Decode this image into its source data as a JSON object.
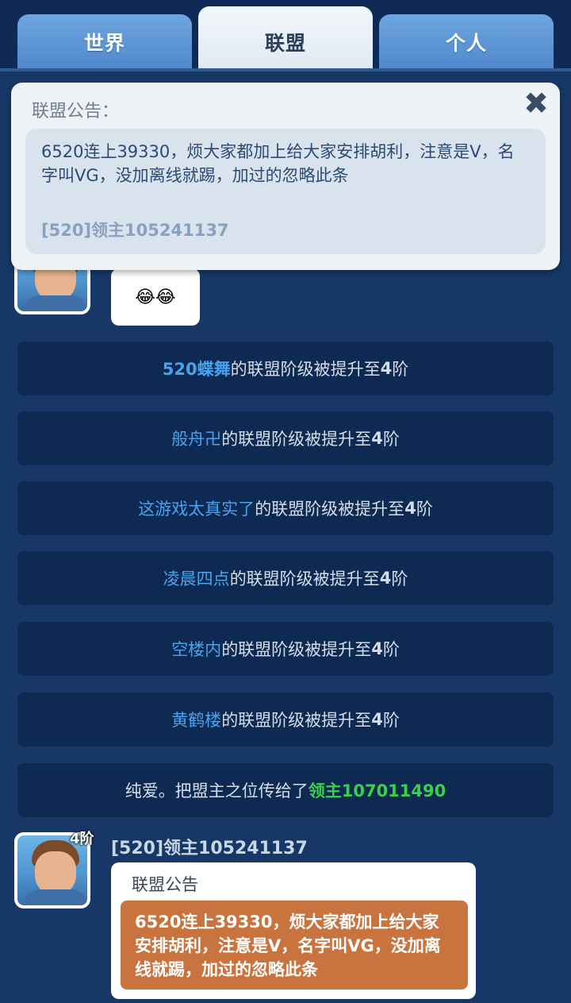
{
  "tabs": {
    "world": "世界",
    "alliance": "联盟",
    "personal": "个人"
  },
  "notice": {
    "title": "联盟公告：",
    "text": "6520连上39330，烦大家都加上给大家安排胡利，注意是V，名字叫VG，没加离线就踢，加过的忽略此条",
    "sender": "[520]领主105241137",
    "close_icon": "✖"
  },
  "emoji_message": {
    "content": "😂😂"
  },
  "system_rows": [
    {
      "name": "520蝶舞",
      "suffix": "的联盟阶级被提升至",
      "level": "4",
      "unit": "阶"
    },
    {
      "name": "般舟卍",
      "suffix": "的联盟阶级被提升至",
      "level": "4",
      "unit": "阶"
    },
    {
      "name": "这游戏太真实了",
      "suffix": "的联盟阶级被提升至",
      "level": "4",
      "unit": "阶"
    },
    {
      "name": "凌晨四点",
      "suffix": "的联盟阶级被提升至",
      "level": "4",
      "unit": "阶"
    },
    {
      "name": "空楼内",
      "suffix": "的联盟阶级被提升至",
      "level": "4",
      "unit": "阶"
    },
    {
      "name": "黄鹤楼",
      "suffix": "的联盟阶级被提升至",
      "level": "4",
      "unit": "阶"
    }
  ],
  "transfer_row": {
    "prefix": "纯爱。把盟主之位传给了",
    "target": "领主107011490"
  },
  "chat_message": {
    "level_badge": "4阶",
    "sender": "[520]领主105241137",
    "title": "联盟公告",
    "content": "6520连上39330，烦大家都加上给大家安排胡利，注意是V，名字叫VG，没加离线就踢，加过的忽略此条"
  },
  "colors": {
    "background": "#173866",
    "row_bg": "#0f2a52",
    "name_blue": "#48a3ee",
    "lord_green": "#39d04a",
    "announcement_orange": "#c9733f"
  }
}
